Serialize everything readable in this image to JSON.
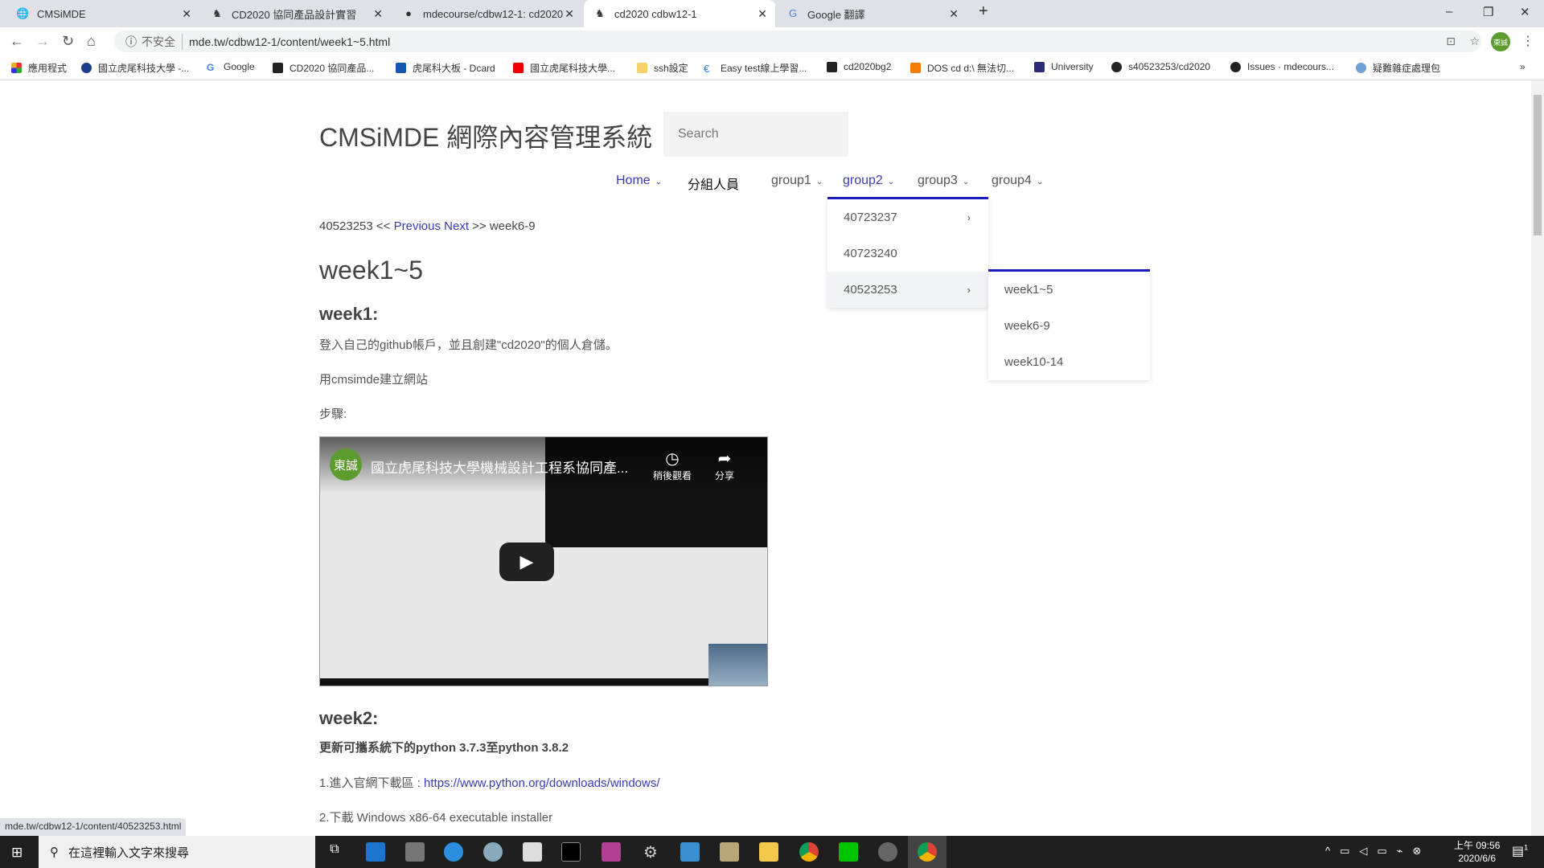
{
  "browser": {
    "tabs": [
      {
        "label": "CMSiMDE",
        "icon": "globe-icon"
      },
      {
        "label": "CD2020 協同產品設計實習",
        "icon": "camel-icon"
      },
      {
        "label": "mdecourse/cdbw12-1: cd2020",
        "icon": "github-icon"
      },
      {
        "label": "cd2020 cdbw12-1",
        "icon": "camel-icon",
        "active": true
      },
      {
        "label": "Google 翻譯",
        "icon": "translate-icon"
      }
    ],
    "new_tab": "+",
    "security": "不安全",
    "url": "mde.tw/cdbw12-1/content/week1~5.html",
    "profile": "東誠",
    "bookmarks": [
      "應用程式",
      "國立虎尾科技大學 -...",
      "Google",
      "CD2020 協同產品...",
      "虎尾科大板 - Dcard",
      "國立虎尾科技大學...",
      "ssh設定",
      "Easy test線上學習...",
      "cd2020bg2",
      "DOS cd d:\\ 無法切...",
      "University",
      "s40523253/cd2020",
      "Issues · mdecours...",
      "疑難雜症處理包"
    ],
    "more": "»",
    "status_url": "mde.tw/cdbw12-1/content/40523253.html"
  },
  "site": {
    "title": "CMSiMDE 網際內容管理系統",
    "search_placeholder": "Search",
    "menu": [
      "Home",
      "分組人員",
      "group1",
      "group2",
      "group3",
      "group4"
    ],
    "group2_dropdown": [
      "40723237",
      "40723240",
      "40523253"
    ],
    "submenu": [
      "week1~5",
      "week6-9",
      "week10-14"
    ],
    "link_color": "#3a3ab8",
    "accent": "#1d1dbf"
  },
  "page": {
    "crumb_prev_page": "40523253 <<",
    "prev": "Previous",
    "next": "Next",
    "crumb_next_page": ">> week6-9",
    "h1": "week1~5",
    "week1": "week1:",
    "p1": "登入自己的github帳戶，並且創建\"cd2020\"的個人倉儲。",
    "p2": "用cmsimde建立網站",
    "p3": "步驟:",
    "video": {
      "channel": "東誠",
      "title": "國立虎尾科技大學機械設計工程系協同產...",
      "watch_later": "稍後觀看",
      "share": "分享"
    },
    "week2": "week2:",
    "w2_bold": "更新可攜系統下的python 3.7.3至python 3.8.2",
    "w2_step1": "1.進入官網下載區 : ",
    "w2_link": "https://www.python.org/downloads/windows/",
    "w2_step2": "2.下載 Windows x86-64 executable installer"
  },
  "taskbar": {
    "search": "在這裡輸入文字來搜尋",
    "time": "上午 09:56",
    "date": "2020/6/6",
    "notif": "1"
  }
}
